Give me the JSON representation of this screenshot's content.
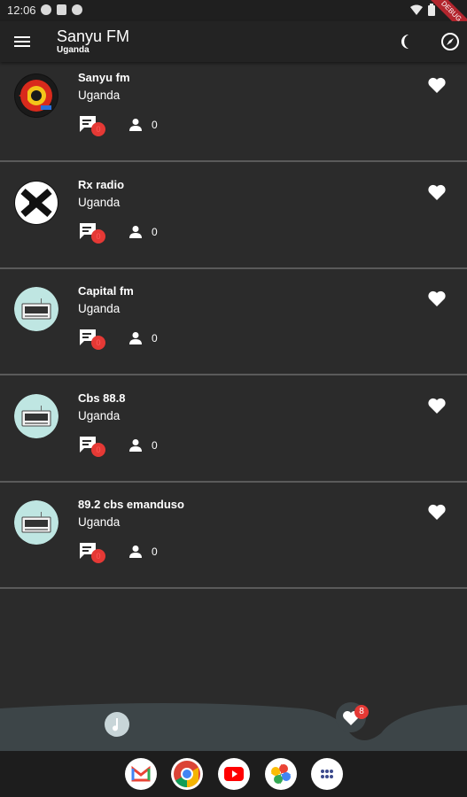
{
  "status_bar": {
    "time": "12:06",
    "debug_label": "DEBUG"
  },
  "app_bar": {
    "title": "Sanyu FM",
    "subtitle": "Uganda"
  },
  "stations": [
    {
      "name": "Sanyu fm",
      "country": "Uganda",
      "comments": "0",
      "listeners": "0",
      "logo": "sanyu-logo"
    },
    {
      "name": "Rx radio",
      "country": "Uganda",
      "comments": "0",
      "listeners": "0",
      "logo": "rx-logo"
    },
    {
      "name": "Capital fm",
      "country": "Uganda",
      "comments": "0",
      "listeners": "0",
      "logo": "radio-placeholder"
    },
    {
      "name": "Cbs 88.8",
      "country": "Uganda",
      "comments": "0",
      "listeners": "0",
      "logo": "radio-placeholder"
    },
    {
      "name": "89.2 cbs emanduso",
      "country": "Uganda",
      "comments": "0",
      "listeners": "0",
      "logo": "radio-placeholder"
    }
  ],
  "bottom_nav": {
    "favorites_count": "8"
  },
  "dock_apps": [
    "gmail",
    "chrome",
    "youtube",
    "photos",
    "app-drawer"
  ],
  "colors": {
    "background": "#2b2b2b",
    "appbar": "#232323",
    "badge": "#e53935",
    "wave": "#3d4548"
  }
}
